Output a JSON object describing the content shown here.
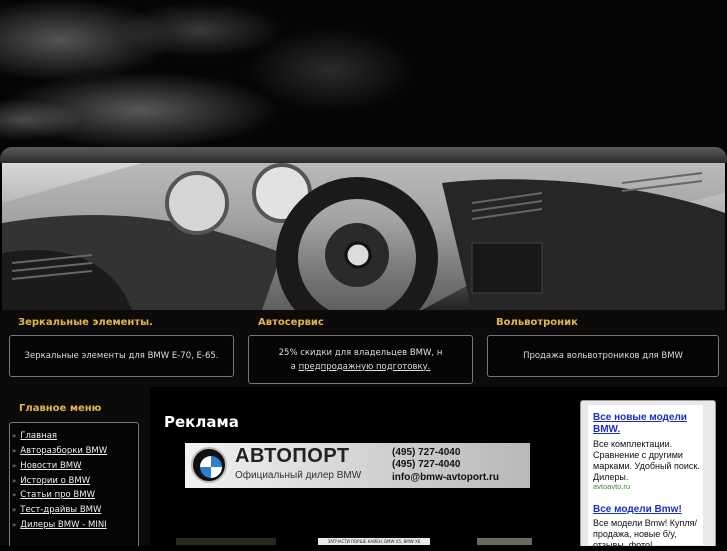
{
  "features": [
    {
      "title": "Зеркальные элементы.",
      "text": "Зеркальные элементы для BMW E-70, E-65.",
      "text2": "",
      "link": ""
    },
    {
      "title": "Автосервис",
      "text": "25% скидки для владельцев BMW, н",
      "text2": "а ",
      "link": "предпродажную подготовку."
    },
    {
      "title": "Вольвотроник",
      "text": "Продажа вольвотроников для BMW",
      "text2": "",
      "link": ""
    }
  ],
  "menu": {
    "title": "Главное меню",
    "items": [
      "Главная",
      "Авторазборки BMW",
      "Новости BMW",
      "Истории о BMW",
      "Статьи про BMW",
      "Тест-драйвы BMW",
      "Дилеры BMW - MINI"
    ]
  },
  "main": {
    "title": "Реклама",
    "ad": {
      "brand": "АВТОПОРТ",
      "sub": "Официальный дилер BMW",
      "phone1": "(495) 727-4040",
      "phone2": "(495) 727-4040",
      "email": "info@bmw-avtoport.ru"
    },
    "thumb_caption": "ЗАПЧАСТИ ПОРШЕ КАЙЕН, BMW X5, BMW X6"
  },
  "sidebar_ads": [
    {
      "title": "Все новые модели BMW.",
      "text": "Все комплектации. Сравнение с другими марками. Удобный поиск. Дилеры.",
      "url": "avtoavto.ru"
    },
    {
      "title": "Все модели Bmw!",
      "text": "Все модели Bmw! Купля/продажа, новые б/у, отзывы, фото!",
      "url": ""
    }
  ],
  "colors": {
    "accent": "#e3b64a",
    "link": "#1a2fc8"
  }
}
